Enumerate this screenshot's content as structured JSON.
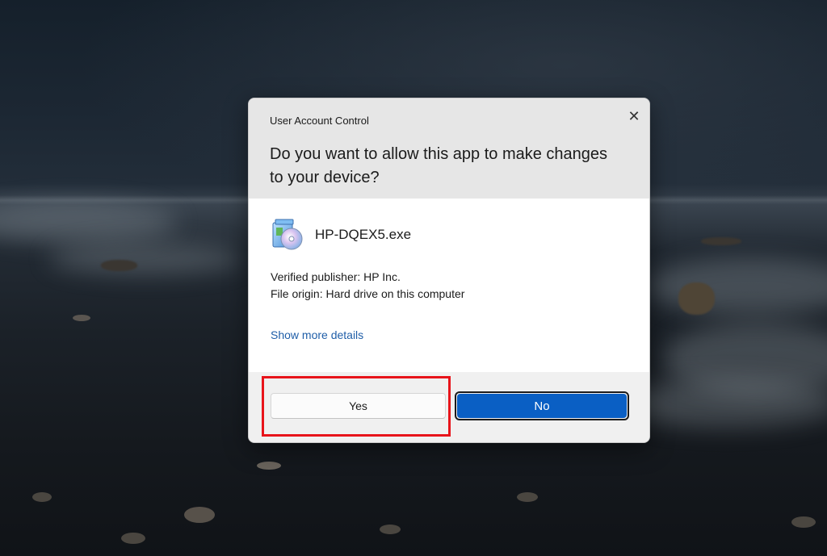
{
  "dialog": {
    "caption": "User Account Control",
    "close_icon": "close-icon",
    "close_glyph": "✕",
    "question": "Do you want to allow this app to make changes to your device?",
    "app": {
      "icon": "installer-icon",
      "name": "HP-DQEX5.exe"
    },
    "publisher": "Verified publisher: HP Inc.",
    "origin": "File origin: Hard drive on this computer",
    "more_details": "Show more details",
    "buttons": {
      "yes": "Yes",
      "no": "No"
    }
  },
  "colors": {
    "accent_button": "#0a5fc4",
    "link": "#1f5ea8",
    "highlight": "#e8141b"
  },
  "highlight": {
    "target": "yes-button"
  }
}
